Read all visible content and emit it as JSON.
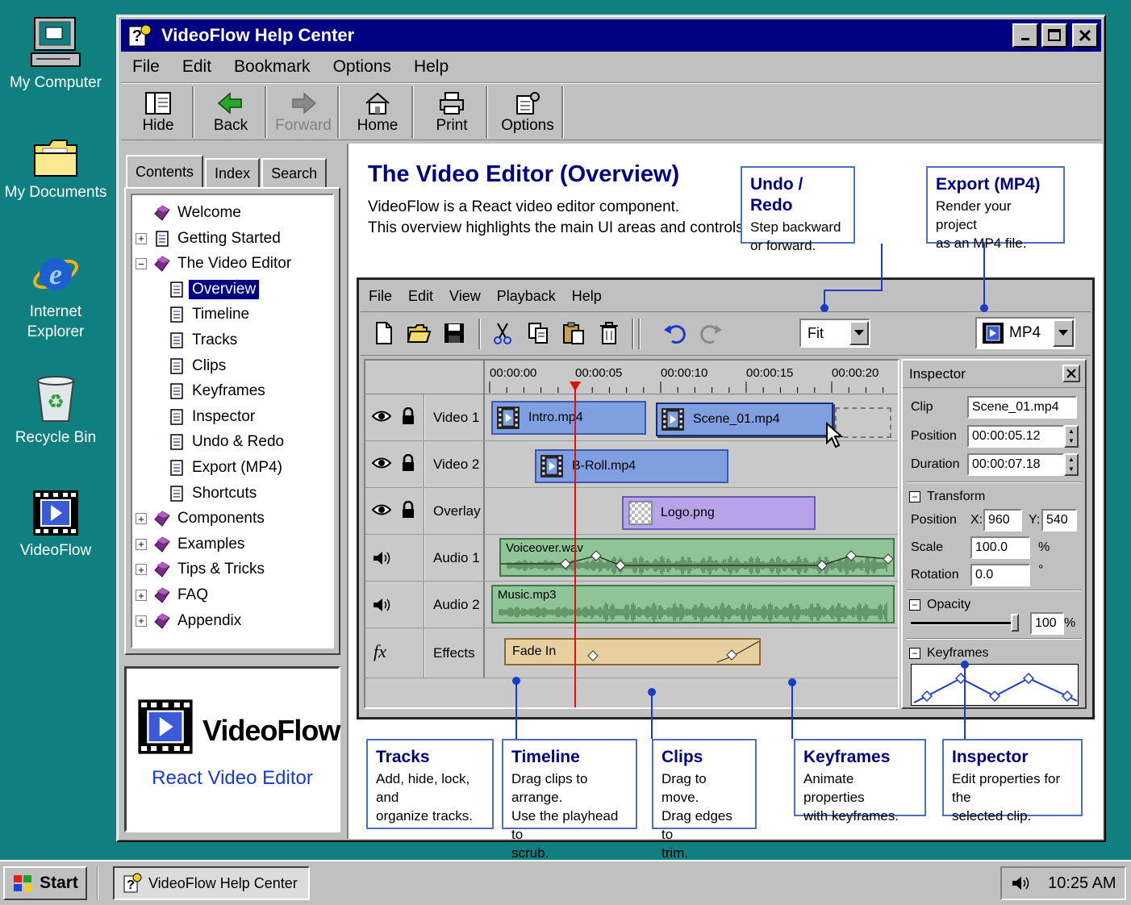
{
  "desktop": {
    "icons": [
      {
        "label": "My Computer",
        "icon": "computer-icon"
      },
      {
        "label": "My Documents",
        "icon": "folder-icon"
      },
      {
        "label_l1": "Internet",
        "label_l2": "Explorer",
        "icon": "internet-explorer-icon"
      },
      {
        "label": "Recycle Bin",
        "icon": "recycle-bin-icon"
      },
      {
        "label": "VideoFlow",
        "icon": "videoflow-icon"
      }
    ]
  },
  "window": {
    "title": "VideoFlow Help Center",
    "menu": [
      "File",
      "Edit",
      "Bookmark",
      "Options",
      "Help"
    ],
    "toolbar": {
      "hide": "Hide",
      "back": "Back",
      "forward": "Forward",
      "home": "Home",
      "print": "Print",
      "options": "Options"
    }
  },
  "nav": {
    "tabs": [
      "Contents",
      "Index",
      "Search"
    ],
    "tree": [
      {
        "label": "Welcome",
        "expander": "",
        "icon": "book-icon"
      },
      {
        "label": "Getting Started",
        "expander": "+",
        "icon": "page-icon"
      },
      {
        "label": "The Video Editor",
        "expander": "−",
        "icon": "book-icon"
      },
      {
        "label": "Overview",
        "expander": "",
        "icon": "page-icon",
        "selected": true
      },
      {
        "label": "Timeline",
        "expander": "",
        "icon": "page-icon"
      },
      {
        "label": "Tracks",
        "expander": "",
        "icon": "page-icon"
      },
      {
        "label": "Clips",
        "expander": "",
        "icon": "page-icon"
      },
      {
        "label": "Keyframes",
        "expander": "",
        "icon": "page-icon"
      },
      {
        "label": "Inspector",
        "expander": "",
        "icon": "page-icon"
      },
      {
        "label": "Undo & Redo",
        "expander": "",
        "icon": "page-icon"
      },
      {
        "label": "Export (MP4)",
        "expander": "",
        "icon": "page-icon"
      },
      {
        "label": "Shortcuts",
        "expander": "",
        "icon": "page-icon"
      },
      {
        "label": "Components",
        "expander": "+",
        "icon": "book-icon"
      },
      {
        "label": "Examples",
        "expander": "+",
        "icon": "book-icon"
      },
      {
        "label": "Tips & Tricks",
        "expander": "+",
        "icon": "book-icon"
      },
      {
        "label": "FAQ",
        "expander": "+",
        "icon": "book-icon"
      },
      {
        "label": "Appendix",
        "expander": "+",
        "icon": "book-icon"
      }
    ],
    "logo": {
      "name": "VideoFlow",
      "tagline": "React Video Editor"
    }
  },
  "page": {
    "title": "The Video Editor (Overview)",
    "intro_l1": "VideoFlow is a React video editor component.",
    "intro_l2": "This overview highlights the main UI areas and controls.",
    "callouts": {
      "undo": {
        "title": "Undo / Redo",
        "l1": "Step backward",
        "l2": "or forward."
      },
      "export": {
        "title": "Export (MP4)",
        "l1": "Render your project",
        "l2": "as an MP4 file."
      },
      "tracks": {
        "title": "Tracks",
        "l1": "Add, hide, lock, and",
        "l2": "organize tracks."
      },
      "timeline": {
        "title": "Timeline",
        "l1": "Drag clips to arrange.",
        "l2": "Use the playhead to",
        "l3": "scrub."
      },
      "clips": {
        "title": "Clips",
        "l1": "Drag to move.",
        "l2": "Drag edges to",
        "l3": "trim."
      },
      "keyframes": {
        "title": "Keyframes",
        "l1": "Animate properties",
        "l2": "with keyframes."
      },
      "inspector": {
        "title": "Inspector",
        "l1": "Edit properties for the",
        "l2": "selected clip."
      }
    }
  },
  "editor": {
    "menu": [
      "File",
      "Edit",
      "View",
      "Playback",
      "Help"
    ],
    "zoom": "Fit",
    "export_format": "MP4",
    "ruler": [
      "00:00:00",
      "00:00:05",
      "00:00:10",
      "00:00:15",
      "00:00:20"
    ],
    "playhead_seconds": 5,
    "tracks": [
      {
        "name": "Video 1",
        "icon": "eye-icon"
      },
      {
        "name": "Video 2",
        "icon": "eye-icon"
      },
      {
        "name": "Overlay",
        "icon": "eye-icon"
      },
      {
        "name": "Audio 1",
        "icon": "speaker-icon"
      },
      {
        "name": "Audio 2",
        "icon": "speaker-icon"
      },
      {
        "name": "Effects",
        "icon": "fx-icon",
        "fx_label": "fx"
      }
    ],
    "clips": {
      "intro": "Intro.mp4",
      "scene": "Scene_01.mp4",
      "broll": "B-Roll.mp4",
      "logo": "Logo.png",
      "voiceover": "Voiceover.wav",
      "music": "Music.mp3",
      "fade": "Fade In"
    },
    "inspector": {
      "title": "Inspector",
      "clip_label": "Clip",
      "clip_value": "Scene_01.mp4",
      "position_label": "Position",
      "position_value": "00:00:05.12",
      "duration_label": "Duration",
      "duration_value": "00:00:07.18",
      "transform_label": "Transform",
      "t_position_label": "Position",
      "x_label": "X:",
      "x_value": "960",
      "y_label": "Y:",
      "y_value": "540",
      "scale_label": "Scale",
      "scale_value": "100.0",
      "scale_unit": "%",
      "rotation_label": "Rotation",
      "rotation_value": "0.0",
      "rotation_unit": "°",
      "opacity_label": "Opacity",
      "opacity_value": "100",
      "opacity_unit": "%",
      "opacity_level": 1.0,
      "keyframes_label": "Keyframes"
    }
  },
  "taskbar": {
    "start": "Start",
    "task": "VideoFlow Help Center",
    "time": "10:25 AM"
  },
  "colors": {
    "desktop": "#0f7f80",
    "titlebar": "#000080",
    "accent": "#000080",
    "playhead": "#e01010",
    "video_clip": "#7f9fe0",
    "overlay_clip": "#b7a3e8",
    "audio_clip": "#8fc497",
    "effect_clip": "#e8cfa0"
  }
}
